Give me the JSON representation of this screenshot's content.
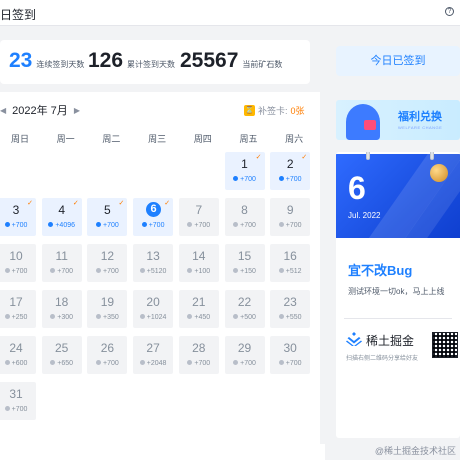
{
  "header": {
    "title": "日签到",
    "help_label": "?"
  },
  "stats": [
    {
      "value": "23",
      "label": "连续签到天数"
    },
    {
      "value": "126",
      "label": "累计签到天数"
    },
    {
      "value": "25567",
      "label": "当前矿石数"
    }
  ],
  "signed_button": "今日已签到",
  "calendar": {
    "month_label": "2022年 7月",
    "prev_arrow": "◀",
    "next_arrow": "▶",
    "makeup_label": "补签卡:",
    "makeup_count": "0张",
    "weekdays": [
      "周日",
      "周一",
      "周二",
      "周三",
      "周四",
      "周五",
      "周六"
    ],
    "days": [
      {
        "day": "1",
        "reward": "+700",
        "done": true,
        "today": false
      },
      {
        "day": "2",
        "reward": "+700",
        "done": true,
        "today": false
      },
      {
        "day": "3",
        "reward": "+700",
        "done": true,
        "today": false
      },
      {
        "day": "4",
        "reward": "+4096",
        "done": true,
        "today": false
      },
      {
        "day": "5",
        "reward": "+700",
        "done": true,
        "today": false
      },
      {
        "day": "6",
        "reward": "+700",
        "done": true,
        "today": true
      },
      {
        "day": "7",
        "reward": "+700",
        "done": false,
        "today": false
      },
      {
        "day": "8",
        "reward": "+700",
        "done": false,
        "today": false
      },
      {
        "day": "9",
        "reward": "+700",
        "done": false,
        "today": false
      },
      {
        "day": "10",
        "reward": "+700",
        "done": false,
        "today": false
      },
      {
        "day": "11",
        "reward": "+700",
        "done": false,
        "today": false
      },
      {
        "day": "12",
        "reward": "+700",
        "done": false,
        "today": false
      },
      {
        "day": "13",
        "reward": "+5120",
        "done": false,
        "today": false
      },
      {
        "day": "14",
        "reward": "+100",
        "done": false,
        "today": false
      },
      {
        "day": "15",
        "reward": "+150",
        "done": false,
        "today": false
      },
      {
        "day": "16",
        "reward": "+512",
        "done": false,
        "today": false
      },
      {
        "day": "17",
        "reward": "+250",
        "done": false,
        "today": false
      },
      {
        "day": "18",
        "reward": "+300",
        "done": false,
        "today": false
      },
      {
        "day": "19",
        "reward": "+350",
        "done": false,
        "today": false
      },
      {
        "day": "20",
        "reward": "+1024",
        "done": false,
        "today": false
      },
      {
        "day": "21",
        "reward": "+450",
        "done": false,
        "today": false
      },
      {
        "day": "22",
        "reward": "+500",
        "done": false,
        "today": false
      },
      {
        "day": "23",
        "reward": "+550",
        "done": false,
        "today": false
      },
      {
        "day": "24",
        "reward": "+600",
        "done": false,
        "today": false
      },
      {
        "day": "25",
        "reward": "+650",
        "done": false,
        "today": false
      },
      {
        "day": "26",
        "reward": "+700",
        "done": false,
        "today": false
      },
      {
        "day": "27",
        "reward": "+2048",
        "done": false,
        "today": false
      },
      {
        "day": "28",
        "reward": "+700",
        "done": false,
        "today": false
      },
      {
        "day": "29",
        "reward": "+700",
        "done": false,
        "today": false
      },
      {
        "day": "30",
        "reward": "+700",
        "done": false,
        "today": false
      },
      {
        "day": "31",
        "reward": "+700",
        "done": false,
        "today": false
      }
    ]
  },
  "welfare_banner": {
    "title": "福利兑换",
    "subtitle": "WELFARE CHANGE"
  },
  "event": {
    "day": "6",
    "month": "Jul. 2022",
    "title": "宜不改Bug",
    "desc": "测试环境一切ok，马上上线"
  },
  "app_promo": {
    "name": "稀土掘金",
    "sub": "扫描右侧二维码分享给好友"
  },
  "watermark": "@稀土掘金技术社区",
  "colors": {
    "accent": "#1e80ff",
    "done_bg": "#eaf2ff",
    "makeup": "#ff7d00"
  }
}
